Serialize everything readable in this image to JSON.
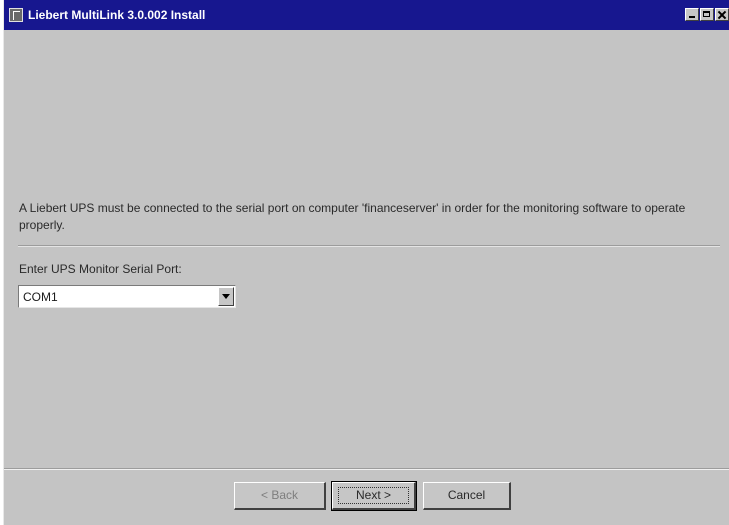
{
  "window": {
    "title": "Liebert MultiLink 3.0.002 Install",
    "title_bar_color": "#17178f",
    "background_color": "#c4c4c4"
  },
  "content": {
    "description": "A Liebert UPS must be connected to the serial port on computer 'financeserver' in order for the monitoring software to operate properly.",
    "port_label": "Enter UPS Monitor Serial Port:",
    "port_select": {
      "selected_value": "COM1"
    }
  },
  "buttons": {
    "back_label": "< Back",
    "next_label": "Next >",
    "cancel_label": "Cancel"
  }
}
